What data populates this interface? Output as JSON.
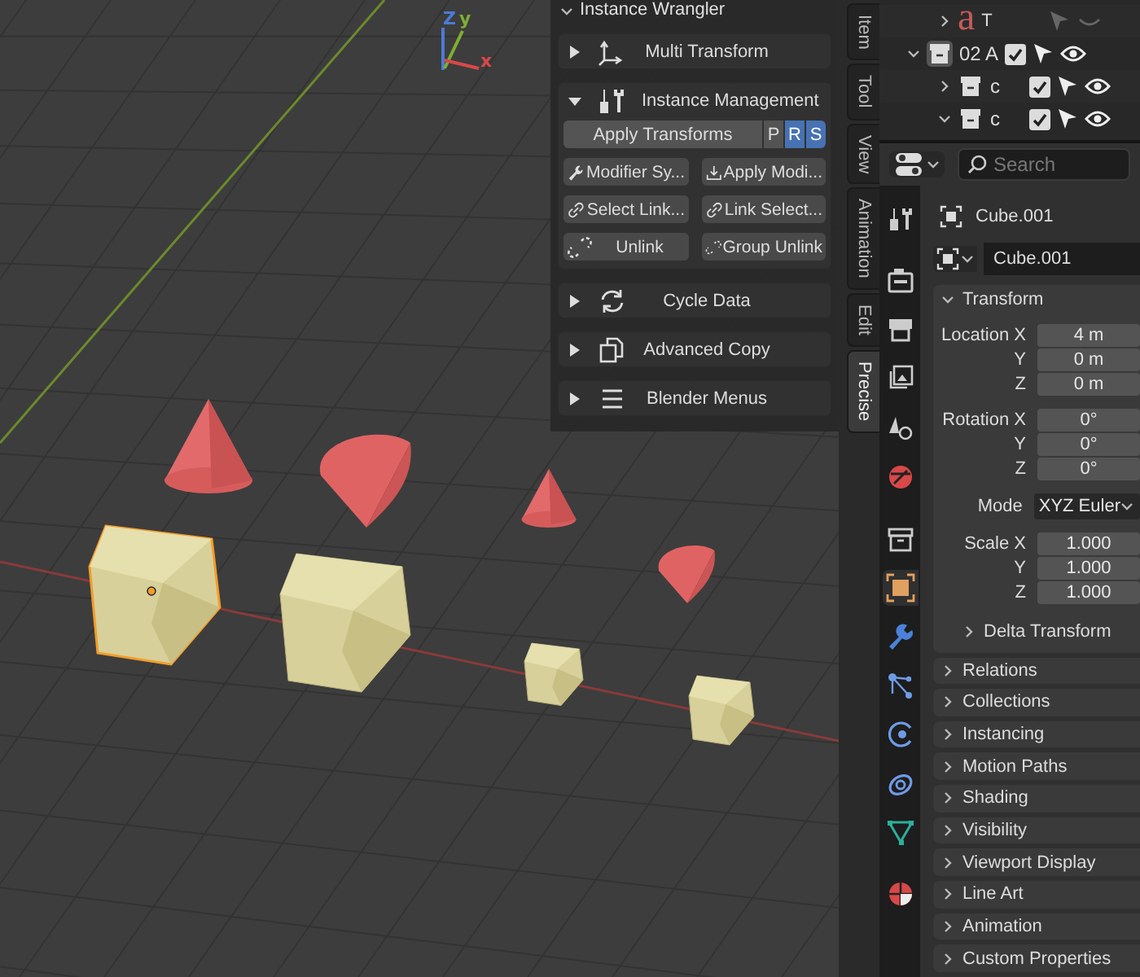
{
  "viewport": {
    "gizmo": [
      {
        "kind": "z",
        "label": "Z"
      },
      {
        "kind": "y",
        "label": "y"
      },
      {
        "kind": "x",
        "label": "x"
      }
    ],
    "objects": [
      {
        "kind": "cone",
        "selected": false
      },
      {
        "kind": "tilted_cone",
        "selected": false
      },
      {
        "kind": "cone",
        "selected": false
      },
      {
        "kind": "tilted_cone",
        "selected": false
      },
      {
        "kind": "cube",
        "selected": true
      },
      {
        "kind": "cube",
        "selected": false
      },
      {
        "kind": "cube",
        "selected": false
      },
      {
        "kind": "cube",
        "selected": false
      }
    ]
  },
  "n_panel": {
    "title": "Instance Wrangler",
    "expanded": true,
    "sections": [
      {
        "label": "Multi Transform",
        "expanded": false
      },
      {
        "label": "Instance Management",
        "expanded": true,
        "apply": {
          "label": "Apply Transforms",
          "toggles": [
            {
              "label": "P",
              "selected": false
            },
            {
              "label": "R",
              "selected": true
            },
            {
              "label": "S",
              "selected": true
            }
          ]
        },
        "buttons": [
          "Modifier Sy...",
          "Apply Modi...",
          "Select Link...",
          "Link Select...",
          "Unlink",
          "Group Unlink"
        ]
      },
      {
        "label": "Cycle Data",
        "expanded": false
      },
      {
        "label": "Advanced Copy",
        "expanded": false
      },
      {
        "label": "Blender Menus",
        "expanded": false
      }
    ]
  },
  "sidebar_tabs": [
    {
      "label": "Item",
      "selected": false
    },
    {
      "label": "Tool",
      "selected": false
    },
    {
      "label": "View",
      "selected": false
    },
    {
      "label": "Animation",
      "selected": false
    },
    {
      "label": "Edit",
      "selected": false
    },
    {
      "label": "Precise",
      "selected": true
    }
  ],
  "outliner": {
    "rows": [
      {
        "kind": "text",
        "icon": "a",
        "name": "T",
        "expanded": false,
        "visible": false
      },
      {
        "kind": "collection",
        "name": "02 A",
        "expanded": true,
        "checked": true,
        "visible": true
      },
      {
        "kind": "collection",
        "name": "c",
        "expanded": false,
        "checked": true,
        "visible": true
      },
      {
        "kind": "collection",
        "name": "c",
        "expanded": true,
        "checked": true,
        "visible": true
      }
    ]
  },
  "properties": {
    "search": {
      "placeholder": "Search"
    },
    "object_name": "Cube.001",
    "datablock": "Cube.001",
    "tabs": [
      {
        "selected": false
      },
      {
        "selected": false
      },
      {
        "selected": false
      },
      {
        "selected": false
      },
      {
        "selected": false
      },
      {
        "selected": false
      },
      {
        "selected": false
      },
      {
        "selected": true
      },
      {
        "selected": false
      },
      {
        "selected": false
      },
      {
        "selected": false
      },
      {
        "selected": false
      },
      {
        "selected": false
      },
      {
        "selected": false
      }
    ],
    "transform": {
      "label": "Transform",
      "expanded": true,
      "groups": [
        {
          "kind": "fields",
          "rows": [
            {
              "label": "Location X",
              "value": "4 m"
            },
            {
              "label": "Y",
              "value": "0 m"
            },
            {
              "label": "Z",
              "value": "0 m"
            }
          ]
        },
        {
          "kind": "fields",
          "rows": [
            {
              "label": "Rotation X",
              "value": "0°"
            },
            {
              "label": "Y",
              "value": "0°"
            },
            {
              "label": "Z",
              "value": "0°"
            }
          ]
        },
        {
          "kind": "dropdown",
          "label": "Mode",
          "value": "XYZ Euler"
        },
        {
          "kind": "fields",
          "rows": [
            {
              "label": "Scale X",
              "value": "1.000"
            },
            {
              "label": "Y",
              "value": "1.000"
            },
            {
              "label": "Z",
              "value": "1.000"
            }
          ]
        }
      ],
      "delta": {
        "label": "Delta Transform",
        "expanded": false
      }
    },
    "panels": [
      {
        "label": "Relations",
        "expanded": false
      },
      {
        "label": "Collections",
        "expanded": false
      },
      {
        "label": "Instancing",
        "expanded": false
      },
      {
        "label": "Motion Paths",
        "expanded": false
      },
      {
        "label": "Shading",
        "expanded": false
      },
      {
        "label": "Visibility",
        "expanded": false
      },
      {
        "label": "Viewport Display",
        "expanded": false
      },
      {
        "label": "Line Art",
        "expanded": false
      },
      {
        "label": "Animation",
        "expanded": false
      },
      {
        "label": "Custom Properties",
        "expanded": false
      }
    ]
  }
}
